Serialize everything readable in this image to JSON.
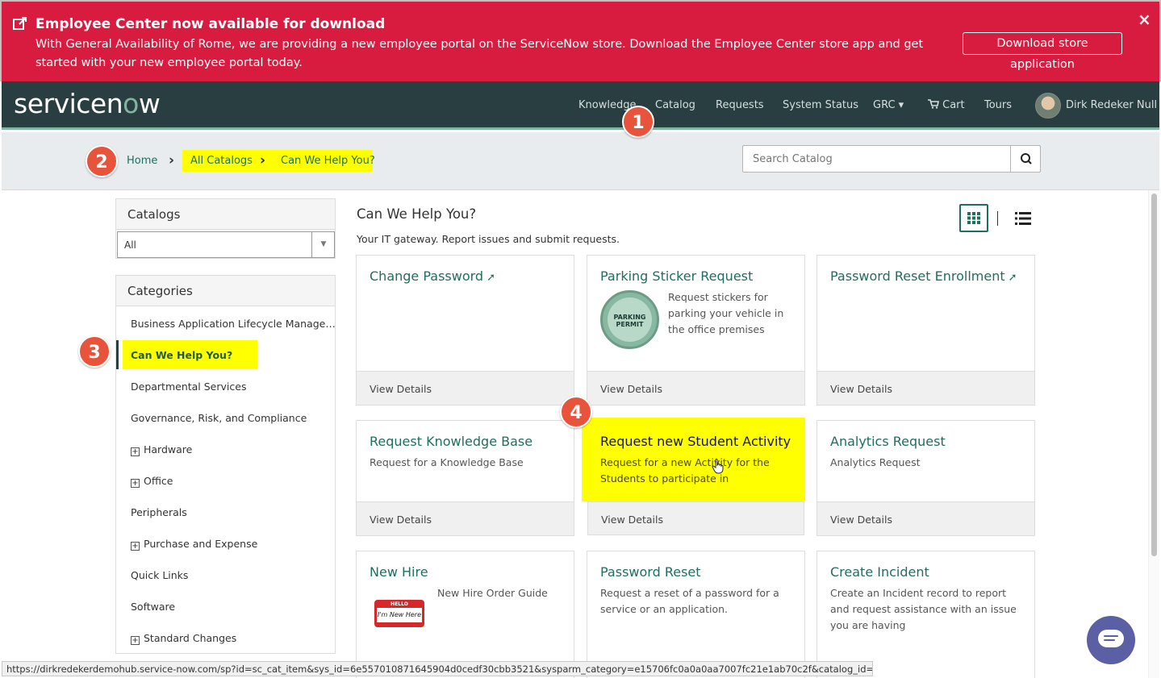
{
  "banner": {
    "title": "Employee Center now available for download",
    "text": "With General Availability of Rome, we are providing a new employee portal on the ServiceNow store. Download the Employee Center store app and get started with your new employee portal today.",
    "button_label": "Download store application",
    "close_icon": "×"
  },
  "nav": {
    "logo_pre": "servicen",
    "logo_o": "o",
    "logo_post": "w",
    "items": [
      "Knowledge",
      "Catalog",
      "Requests",
      "System Status",
      "GRC ▾",
      "Cart",
      "Tours"
    ],
    "user_name": "Dirk Redeker Null"
  },
  "breadcrumb": {
    "home": "Home",
    "all_catalogs": "All Catalogs",
    "current": "Can We Help You?"
  },
  "search": {
    "placeholder": "Search Catalog"
  },
  "badges": [
    "1",
    "2",
    "3",
    "4"
  ],
  "catalogs": {
    "heading": "Catalogs",
    "selected": "All"
  },
  "categories": {
    "heading": "Categories",
    "items": [
      {
        "label": "Business Application Lifecycle Manage…",
        "expandable": false
      },
      {
        "label": "Can We Help You?",
        "expandable": false,
        "active": true
      },
      {
        "label": "Departmental Services",
        "expandable": false
      },
      {
        "label": "Governance, Risk, and Compliance",
        "expandable": false
      },
      {
        "label": "Hardware",
        "expandable": true
      },
      {
        "label": "Office",
        "expandable": true
      },
      {
        "label": "Peripherals",
        "expandable": false
      },
      {
        "label": "Purchase and Expense",
        "expandable": true
      },
      {
        "label": "Quick Links",
        "expandable": false
      },
      {
        "label": "Software",
        "expandable": false
      },
      {
        "label": "Standard Changes",
        "expandable": true
      }
    ]
  },
  "main": {
    "title": "Can We Help You?",
    "description": "Your IT gateway. Report issues and submit requests.",
    "view_details": "View Details",
    "cards": [
      {
        "title": "Change Password",
        "external": true,
        "desc": ""
      },
      {
        "title": "Parking Sticker Request",
        "external": false,
        "desc": "Request stickers for parking your vehicle in the office premises",
        "image": "parking-permit"
      },
      {
        "title": "Password Reset Enrollment",
        "external": true,
        "desc": ""
      },
      {
        "title": "Request Knowledge Base",
        "external": false,
        "desc": "Request for a Knowledge Base"
      },
      {
        "title": "Request new Student Activity",
        "external": false,
        "desc": "Request for a new Activity for the Students to participate in",
        "highlighted": true
      },
      {
        "title": "Analytics Request",
        "external": false,
        "desc": "Analytics Request"
      },
      {
        "title": "New Hire",
        "external": false,
        "desc": "New Hire Order Guide",
        "image": "hello-badge"
      },
      {
        "title": "Password Reset",
        "external": false,
        "desc": "Request a reset of a password for a service or an application."
      },
      {
        "title": "Create Incident",
        "external": false,
        "desc": "Create an Incident record to report and request assistance with an issue you are having"
      }
    ],
    "parking_label": "PARKING PERMIT",
    "hello_top": "HELLO",
    "hello_body": "I'm New Here"
  },
  "status_url": "https://dirkredekerdemohub.service-now.com/sp?id=sc_cat_item&sys_id=6e557010871645904d0cedf30cbb3521&sysparm_category=e15706fc0a0a0aa7007fc21e1ab70c2f&catalog_id=-1",
  "colors": {
    "banner": "#d81c3f",
    "nav": "#293e40",
    "accent": "#1f6e5e",
    "highlight": "#ffff00",
    "badge": "#e8533c"
  }
}
